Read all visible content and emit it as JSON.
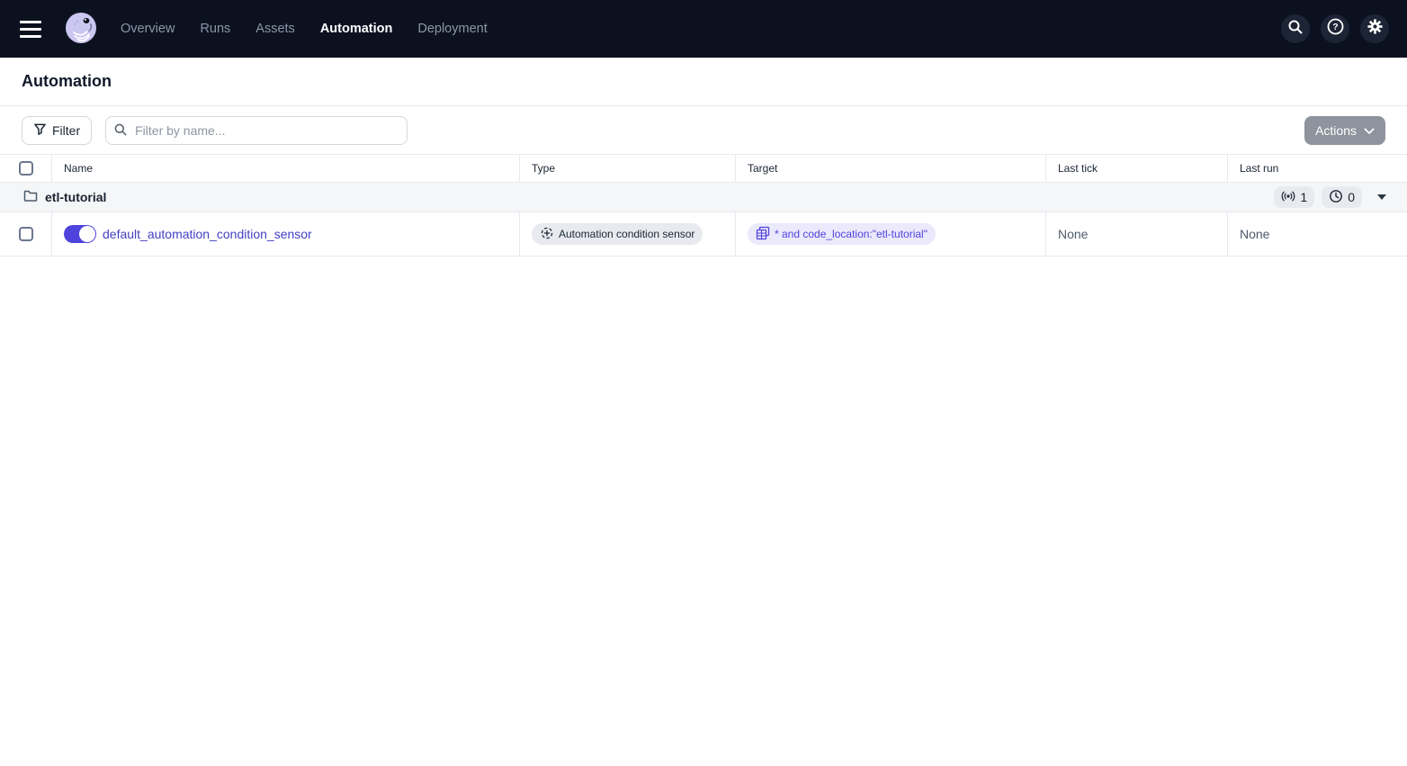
{
  "navbar": {
    "items": [
      {
        "label": "Overview",
        "active": false
      },
      {
        "label": "Runs",
        "active": false
      },
      {
        "label": "Assets",
        "active": false
      },
      {
        "label": "Automation",
        "active": true
      },
      {
        "label": "Deployment",
        "active": false
      }
    ],
    "right_icons": [
      "search-icon",
      "help-icon",
      "settings-icon"
    ]
  },
  "page": {
    "title": "Automation"
  },
  "toolbar": {
    "filter_label": "Filter",
    "search_placeholder": "Filter by name...",
    "actions_label": "Actions"
  },
  "table": {
    "columns": [
      "Name",
      "Type",
      "Target",
      "Last tick",
      "Last run"
    ],
    "group": {
      "name": "etl-tutorial",
      "sensor_count": "1",
      "schedule_count": "0"
    },
    "rows": [
      {
        "name": "default_automation_condition_sensor",
        "enabled": true,
        "type": "Automation condition sensor",
        "target": "* and code_location:\"etl-tutorial\"",
        "last_tick": "None",
        "last_run": "None"
      }
    ]
  },
  "colors": {
    "navbar_bg": "#0c1120",
    "accent": "#4f43dd",
    "link": "#423fc4",
    "tag_lavender_bg": "#ebe9fb",
    "tag_gray_bg": "#e8eaef",
    "group_row_bg": "#f4f6f8",
    "border": "#e7e9ee",
    "disabled_button_bg": "#8e949d"
  }
}
